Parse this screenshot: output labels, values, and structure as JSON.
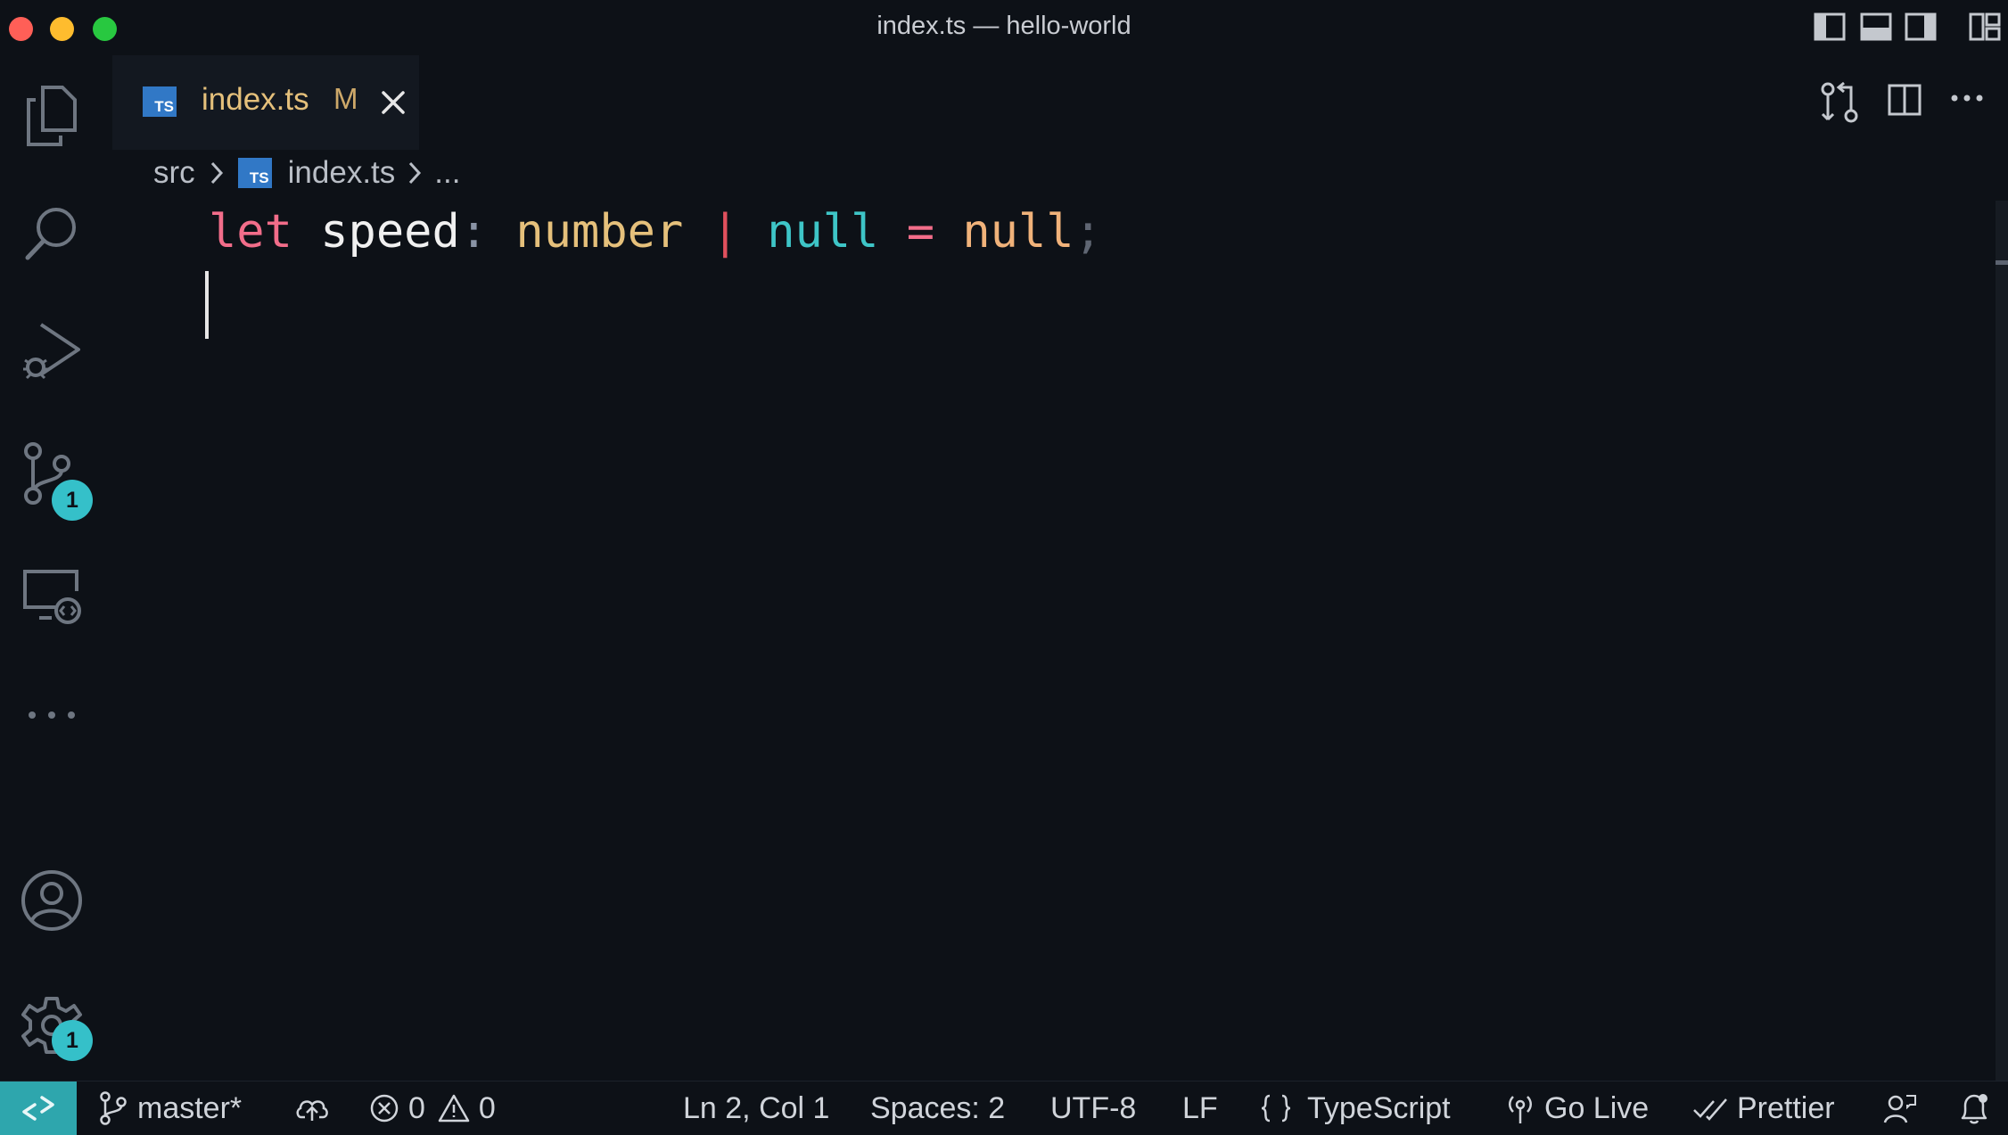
{
  "window": {
    "title": "index.ts — hello-world",
    "traffic_colors": [
      "#ff5f57",
      "#febc2e",
      "#28c840"
    ]
  },
  "activity_bar": {
    "items": [
      {
        "name": "explorer",
        "icon": "files-icon"
      },
      {
        "name": "search",
        "icon": "search-icon"
      },
      {
        "name": "run-debug",
        "icon": "run-debug-icon"
      },
      {
        "name": "source-control",
        "icon": "source-control-icon",
        "badge": "1"
      },
      {
        "name": "remote-explorer",
        "icon": "remote-explorer-icon"
      },
      {
        "name": "more",
        "icon": "ellipsis-icon"
      }
    ],
    "accounts_icon": "account-icon",
    "settings_icon": "gear-icon",
    "settings_badge": "1"
  },
  "tabs": [
    {
      "icon_text": "TS",
      "label": "index.ts",
      "modified": "M",
      "active": true
    }
  ],
  "breadcrumb": {
    "folder": "src",
    "file_icon_text": "TS",
    "file": "index.ts",
    "more": "..."
  },
  "editor": {
    "tokens": [
      {
        "text": "let",
        "color": "#f26d8a"
      },
      {
        "text": " ",
        "color": "#e6e6e6"
      },
      {
        "text": "speed",
        "color": "#f0f0f0"
      },
      {
        "text": ":",
        "color": "#8a94a6"
      },
      {
        "text": " ",
        "color": "#e6e6e6"
      },
      {
        "text": "number",
        "color": "#e5c07b"
      },
      {
        "text": " ",
        "color": "#e6e6e6"
      },
      {
        "text": "|",
        "color": "#e0505d"
      },
      {
        "text": " ",
        "color": "#e6e6e6"
      },
      {
        "text": "null",
        "color": "#3ec5c7"
      },
      {
        "text": " ",
        "color": "#e6e6e6"
      },
      {
        "text": "=",
        "color": "#f26d8a"
      },
      {
        "text": " ",
        "color": "#e6e6e6"
      },
      {
        "text": "null",
        "color": "#f0b27a"
      },
      {
        "text": ";",
        "color": "#5f6673"
      }
    ]
  },
  "status_bar": {
    "branch": "master*",
    "errors": "0",
    "warnings": "0",
    "position": "Ln 2, Col 1",
    "spaces": "Spaces: 2",
    "encoding": "UTF-8",
    "eol": "LF",
    "language": "TypeScript",
    "go_live": "Go Live",
    "prettier": "Prettier",
    "remote_color": "#2ea6ad"
  }
}
